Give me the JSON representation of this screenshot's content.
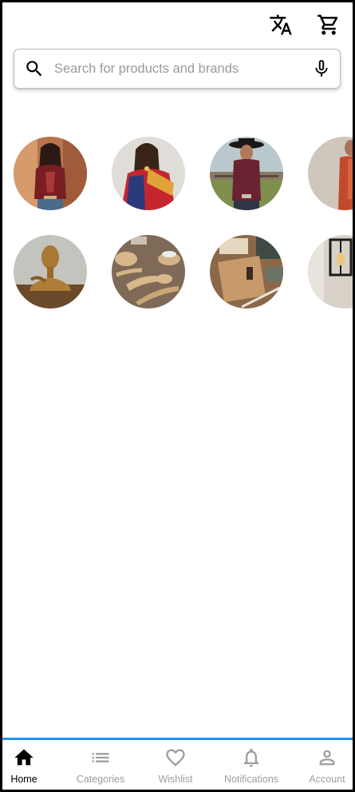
{
  "header": {
    "translate_icon": "translate-icon",
    "cart_icon": "shopping-cart-icon"
  },
  "search": {
    "placeholder": "Search for products and brands",
    "value": "",
    "search_icon": "search-icon",
    "mic_icon": "microphone-icon"
  },
  "categories": {
    "row1": [
      {
        "name": "women-ethnic-top"
      },
      {
        "name": "saree"
      },
      {
        "name": "western-shirt"
      },
      {
        "name": "men-shirt"
      }
    ],
    "row2": [
      {
        "name": "decor-statue"
      },
      {
        "name": "wooden-kitchenware"
      },
      {
        "name": "stationery-notebook"
      },
      {
        "name": "lighting-lamp"
      }
    ]
  },
  "bottom_nav": {
    "items": [
      {
        "label": "Home",
        "icon": "home-icon",
        "active": true
      },
      {
        "label": "Categories",
        "icon": "list-icon",
        "active": false
      },
      {
        "label": "Wishlist",
        "icon": "heart-icon",
        "active": false
      },
      {
        "label": "Notifications",
        "icon": "bell-icon",
        "active": false
      },
      {
        "label": "Account",
        "icon": "person-icon",
        "active": false
      }
    ]
  },
  "colors": {
    "accent": "#2196f3",
    "active_nav": "#000000",
    "inactive_nav": "#9e9e9e"
  }
}
